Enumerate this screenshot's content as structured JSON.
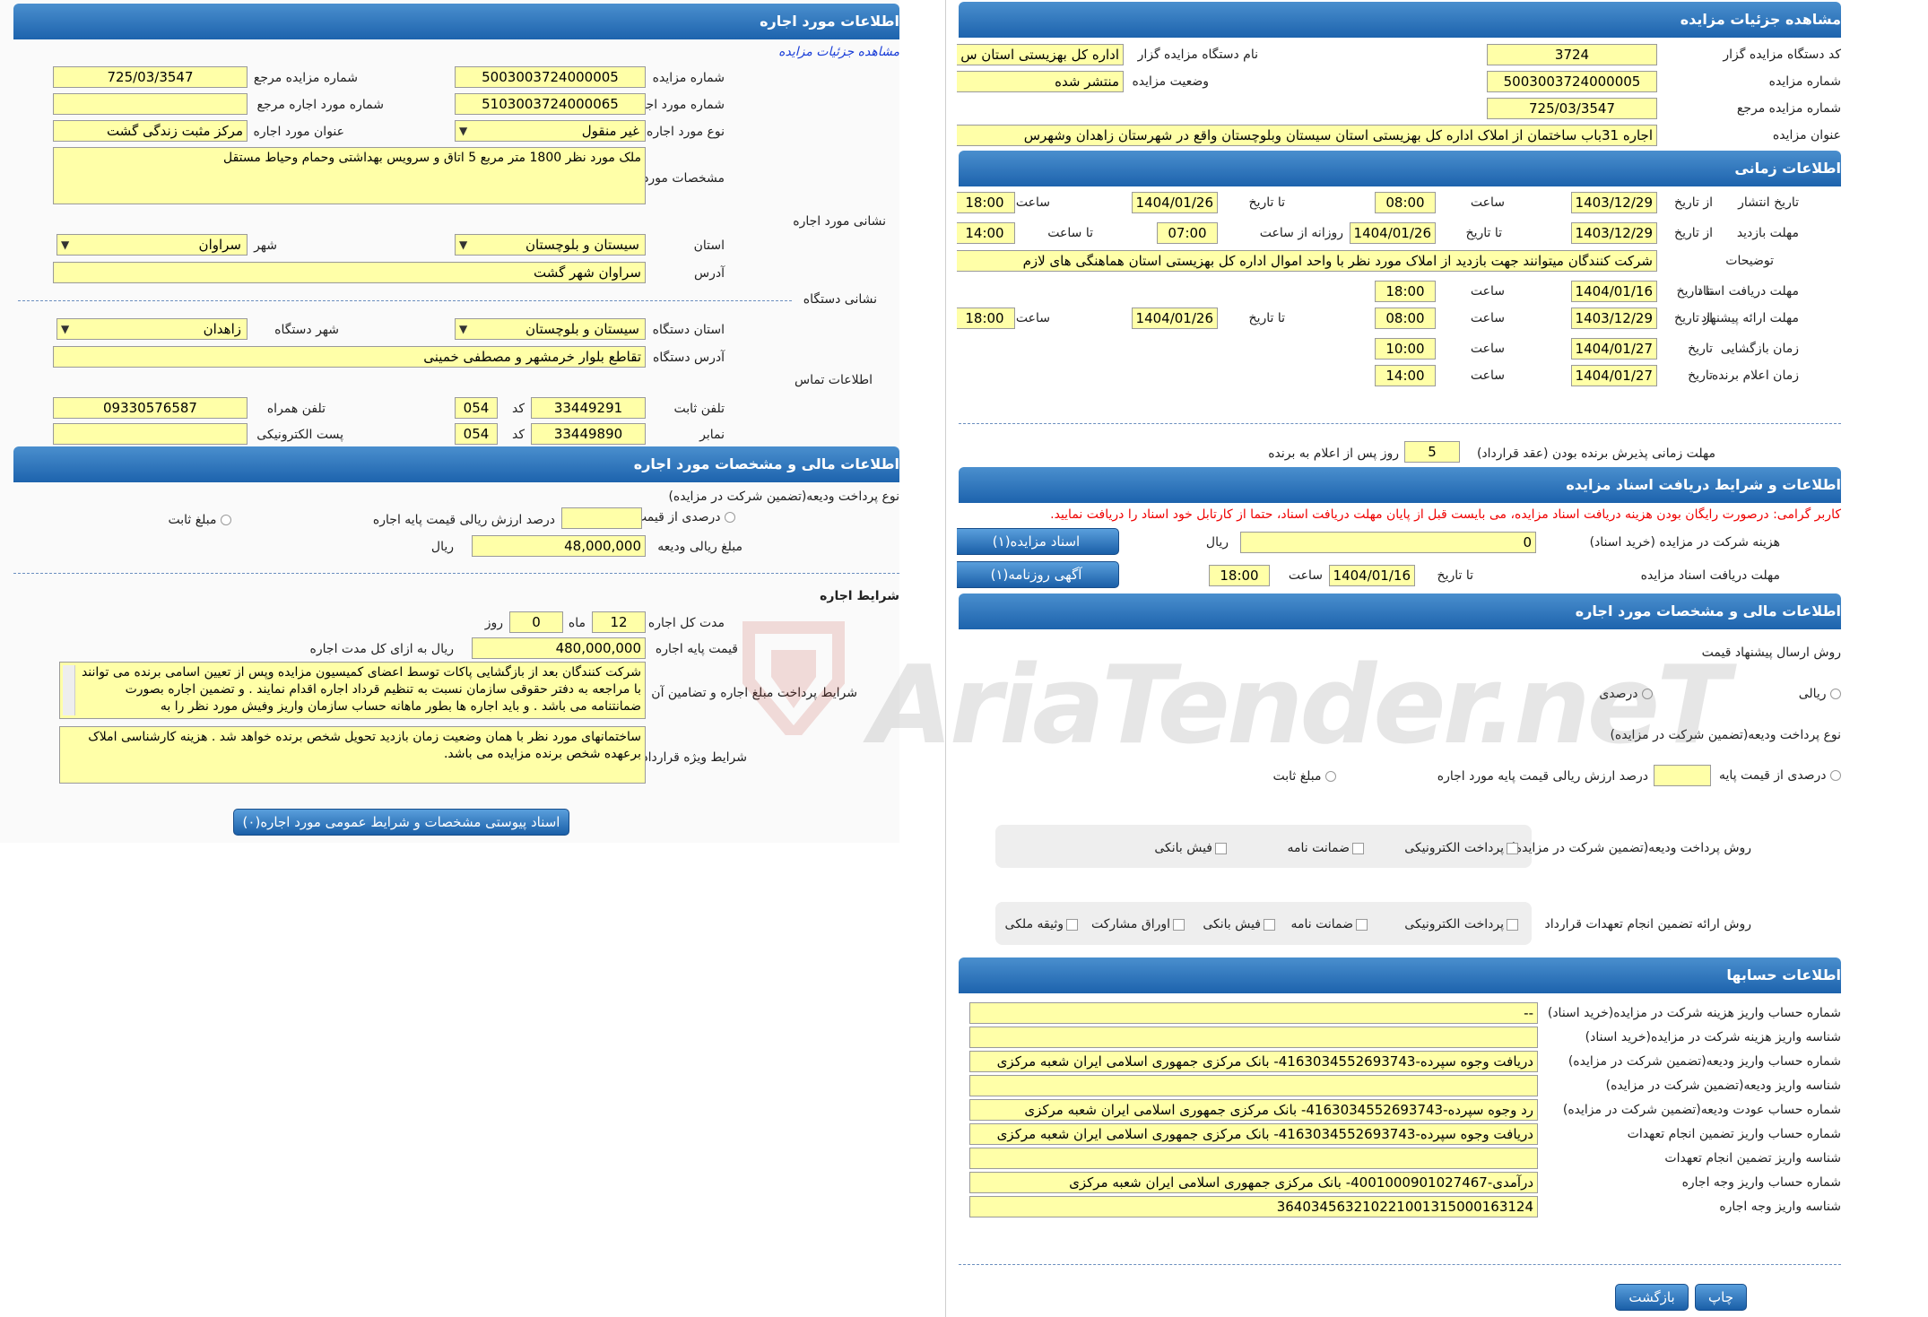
{
  "right": {
    "sec1": {
      "title": "مشاهده جزئیات مزایده",
      "code_label": "کد دستگاه مزایده گزار",
      "code": "3724",
      "org_label": "نام دستگاه مزایده گزار",
      "org": "اداره کل بهزیستی استان س",
      "num_label": "شماره مزایده",
      "num": "5003003724000005",
      "status_label": "وضعیت مزایده",
      "status": "منتشر شده",
      "ref_label": "شماره مزایده مرجع",
      "ref": "725/03/3547",
      "subject_label": "عنوان مزایده",
      "subject": "اجاره 31باب ساختمان از املاک اداره کل بهزیستی استان سیستان وبلوچستان واقع در شهرستان زاهدان وشهرس"
    },
    "sec2": {
      "title": "اطلاعات زمانی",
      "pub_label": "تاریخ انتشار",
      "from_date": "از تاریخ",
      "to_date": "تا تاریخ",
      "hour": "ساعت",
      "pub_from": "1403/12/29",
      "pub_from_t": "08:00",
      "pub_to": "1404/01/26",
      "pub_to_t": "18:00",
      "visit_label": "مهلت بازدید",
      "visit_from": "1403/12/29",
      "visit_to": "1404/01/26",
      "daily_from": "روزانه از ساعت",
      "daily_from_v": "07:00",
      "to_hour": "تا ساعت",
      "to_hour_v": "14:00",
      "desc_label": "توضیحات",
      "desc": "شرکت کنندگان میتوانند جهت بازدید از املاک مورد نظر با واحد اموال اداره کل بهزیستی استان هماهنگی های لازم",
      "doc_label": "مهلت دریافت اسناد",
      "doc_to": "1404/01/16",
      "doc_to_t": "18:00",
      "offer_label": "مهلت ارائه پیشنهاد",
      "offer_from": "1403/12/29",
      "offer_from_t": "08:00",
      "offer_to": "1404/01/26",
      "offer_to_t": "18:00",
      "open_label": "زمان بازگشایی",
      "date_label": "تاریخ",
      "open_date": "1404/01/27",
      "open_t": "10:00",
      "winner_label": "زمان اعلام برنده",
      "winner_date": "1404/01/27",
      "winner_t": "14:00",
      "accept_label": "مهلت زمانی پذیرش برنده بودن (عقد قرارداد)",
      "accept_v": "5",
      "accept_suffix": "روز پس از اعلام به برنده"
    },
    "sec3": {
      "title": "اطلاعات و شرایط دریافت اسناد مزایده",
      "notice": "کاربر گرامی: درصورت رایگان بودن هزینه دریافت اسناد مزایده، می بایست قبل از پایان مهلت دریافت اسناد، حتما از کارتابل خود اسناد را دریافت نمایید.",
      "fee_label": "هزینه شرکت در مزایده (خرید اسناد)",
      "fee": "0",
      "rial": "ریال",
      "btn_docs": "اسناد مزایده(۱)",
      "deadline_label": "مهلت دریافت اسناد مزایده",
      "to_date": "تا تاریخ",
      "deadline": "1404/01/16",
      "hour": "ساعت",
      "deadline_t": "18:00",
      "btn_news": "آگهی روزنامه(۱)"
    },
    "sec4": {
      "title": "اطلاعات مالی و مشخصات مورد اجاره",
      "method_label": "روش ارسال پیشنهاد قیمت",
      "opt_rial": "ریالی",
      "opt_percent": "درصدی",
      "deposit_type_label": "نوع پرداخت ودیعه(تضمین شرکت در مزایده)",
      "dep_percent": "درصدی از قیمت پایه",
      "dep_percent_suffix": "درصد ارزش ریالی قیمت پایه مورد اجاره",
      "dep_fixed": "مبلغ ثابت",
      "pay_method_label": "روش پرداخت ودیعه(تضمین شرکت در مزایده)",
      "pm_epay": "پرداخت الکترونیکی",
      "pm_guarantee": "ضمانت نامه",
      "pm_receipt": "فیش بانکی",
      "guar_method_label": "روش ارائه تضمین انجام تعهدات قرارداد",
      "gm_epay": "پرداخت الکترونیکی",
      "gm_guarantee": "ضمانت نامه",
      "gm_receipt": "فیش بانکی",
      "gm_bonds": "اوراق مشارکت",
      "gm_property": "وثیقه ملکی"
    },
    "sec5": {
      "title": "اطلاعات حسابها",
      "rows": [
        {
          "label": "شماره حساب واریز هزینه شرکت در مزایده(خرید اسناد)",
          "value": "--"
        },
        {
          "label": "شناسه واریز هزینه شرکت در مزایده(خرید اسناد)",
          "value": ""
        },
        {
          "label": "شماره حساب واریز ودیعه(تضمین شرکت در مزایده)",
          "value": "دریافت وجوه سپرده-4163034552693743- بانک مرکزی جمهوری اسلامی ایران شعبه مرکزی"
        },
        {
          "label": "شناسه واریز ودیعه(تضمین شرکت در مزایده)",
          "value": ""
        },
        {
          "label": "شماره حساب عودت ودیعه(تضمین شرکت در مزایده)",
          "value": "رد وجوه سپرده-4163034552693743- بانک مرکزی جمهوری اسلامی ایران شعبه مرکزی"
        },
        {
          "label": "شماره حساب واریز تضمین انجام تعهدات",
          "value": "دریافت وجوه سپرده-4163034552693743- بانک مرکزی جمهوری اسلامی ایران شعبه مرکزی"
        },
        {
          "label": "شناسه واریز تضمین انجام تعهدات",
          "value": ""
        },
        {
          "label": "شماره حساب واریز وجه اجاره",
          "value": "درآمدی-4001000901027467- بانک مرکزی جمهوری اسلامی ایران شعبه مرکزی"
        },
        {
          "label": "شناسه واریز وجه اجاره",
          "value": "364034563210221001315000163124"
        }
      ],
      "btn_print": "چاپ",
      "btn_back": "بازگشت"
    }
  },
  "left": {
    "sec1": {
      "title": "اطلاعات مورد اجاره",
      "link": "مشاهده جزئیات مزایده",
      "auction_num_label": "شماره مزایده",
      "auction_num": "5003003724000005",
      "ref_label": "شماره مزایده مرجع",
      "ref": "725/03/3547",
      "item_num_label": "شماره مورد اجاره",
      "item_num": "5103003724000065",
      "item_ref_label": "شماره مورد اجاره مرجع",
      "item_ref": "",
      "type_label": "نوع مورد اجاره",
      "type": "غیر منقول",
      "item_title_label": "عنوان مورد اجاره",
      "item_title": "مرکز مثبت زندگی گشت",
      "spec_label": "مشخصات مورد اجاره",
      "spec": "ملک مورد نظر 1800 متر مربع 5 اتاق و سرویس بهداشتی وحمام وحیاط مستقل",
      "addr_head": "نشانی مورد اجاره",
      "province_label": "استان",
      "province": "سیستان و بلوچستان",
      "city_label": "شهر",
      "city": "سراوان",
      "addr_label": "آدرس",
      "addr": "سراوان شهر گشت",
      "org_addr_head": "نشانی دستگاه",
      "org_prov_label": "استان دستگاه",
      "org_prov": "سیستان و بلوچستان",
      "org_city_label": "شهر دستگاه",
      "org_city": "زاهدان",
      "org_addr_label": "آدرس دستگاه",
      "org_addr": "تقاطع بلوار خرمشهر و مصطفی خمینی",
      "contact_head": "اطلاعات تماس",
      "tel_label": "تلفن ثابت",
      "tel": "33449291",
      "code_label": "کد",
      "tel_code": "054",
      "mobile_label": "تلفن همراه",
      "mobile": "09330576587",
      "fax_label": "نمابر",
      "fax": "33449890",
      "fax_code": "054",
      "email_label": "پست الکترونیکی",
      "email": ""
    },
    "sec2": {
      "title": "اطلاعات مالی و مشخصات مورد اجاره",
      "deposit_type_label": "نوع پرداخت ودیعه(تضمین شرکت در مزایده)",
      "dep_percent": "درصدی از قیمت پایه",
      "dep_percent_suffix": "درصد ارزش ریالی قیمت پایه اجاره",
      "dep_fixed": "مبلغ ثابت",
      "dep_amount_label": "مبلغ ریالی ودیعه",
      "dep_amount": "48,000,000",
      "rial": "ریال"
    },
    "sec3": {
      "title": "شرایط اجاره",
      "duration_label": "مدت کل اجاره",
      "months": "12",
      "month_lbl": "ماه",
      "days": "0",
      "day_lbl": "روز",
      "base_label": "قیمت پایه اجاره",
      "base": "480,000,000",
      "base_suffix": "ریال به ازای کل مدت اجاره",
      "pay_terms_label": "شرایط پرداخت مبلغ اجاره و تضامین آن",
      "pay_terms": "شرکت کنندگان بعد از بازگشایی پاکات توسط اعضای کمیسیون مزایده وپس از تعیین اسامی برنده می توانند با مراجعه به دفتر حقوقی سازمان نسبت به تنظیم قرداد اجاره اقدام نمایند . و تضمین اجاره بصورت ضمانتنامه می باشد . و باید اجاره ها بطور ماهانه حساب سازمان واریز وفیش مورد نظر را به",
      "special_label": "شرایط ویژه قرارداد",
      "special": "ساختمانهای مورد نظر با همان وضعیت زمان بازدید تحویل شخص برنده خواهد شد . هزینه کارشناسی املاک برعهده شخص برنده مزایده می باشد.",
      "btn_attach": "اسناد پیوستی مشخصات و شرایط عمومی مورد اجاره(۰)"
    }
  },
  "watermark": "AriaTender.neT"
}
